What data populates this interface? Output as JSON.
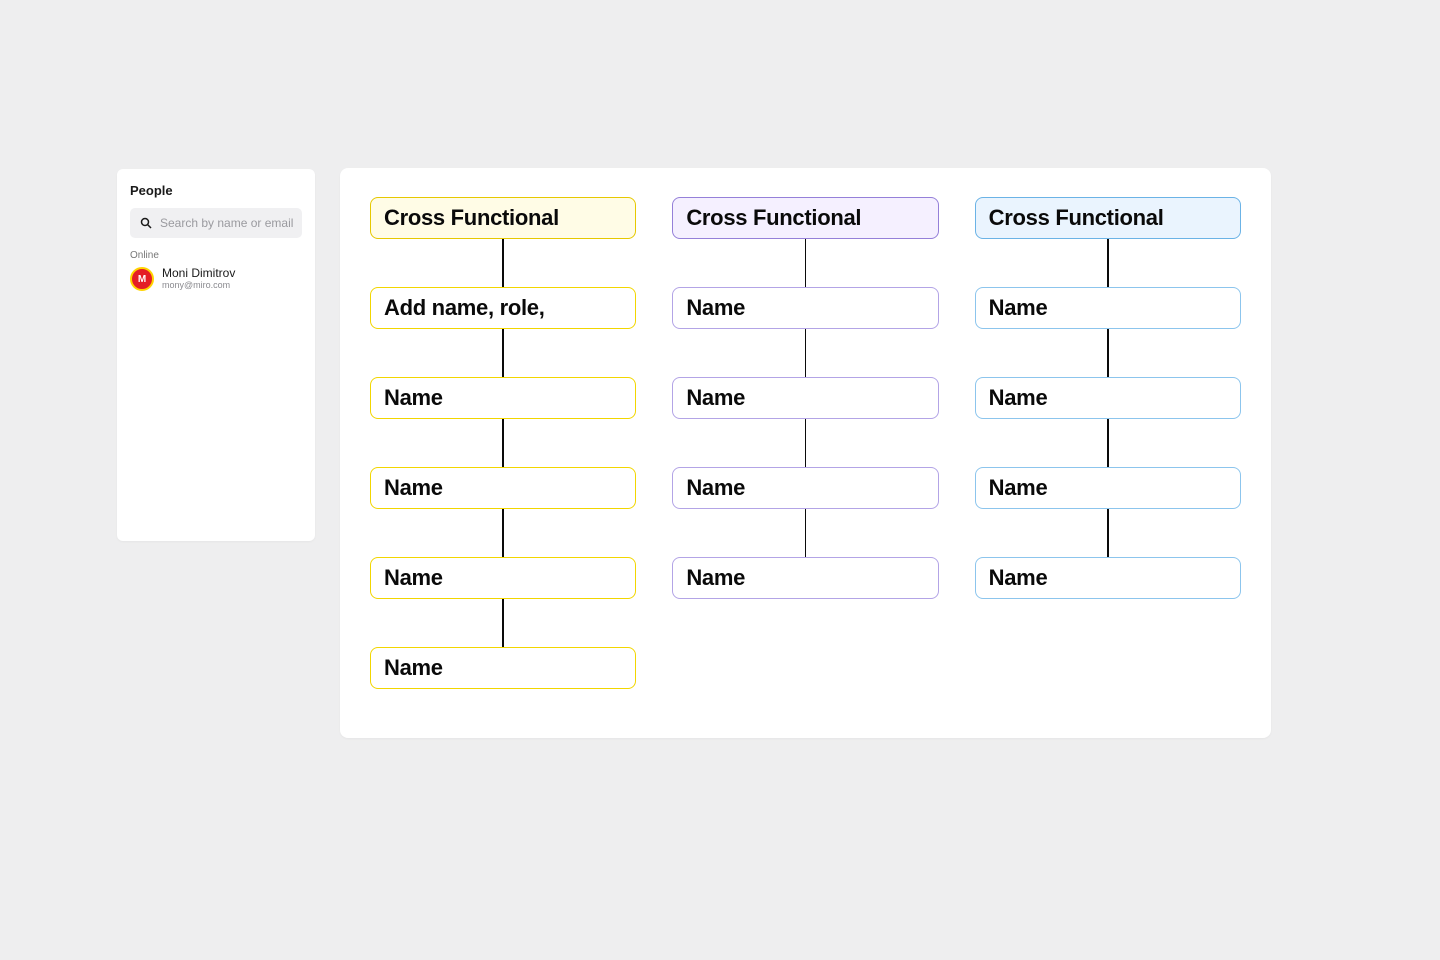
{
  "people_panel": {
    "title": "People",
    "search_placeholder": "Search by name or email",
    "online_label": "Online",
    "users": [
      {
        "initial": "M",
        "name": "Moni Dimitrov",
        "email": "mony@miro.com"
      }
    ]
  },
  "canvas": {
    "columns": [
      {
        "theme": "yellow",
        "header": "Cross Functional",
        "nodes": [
          "Add name, role,",
          "Name",
          "Name",
          "Name",
          "Name"
        ]
      },
      {
        "theme": "purple",
        "header": "Cross Functional",
        "nodes": [
          "Name",
          "Name",
          "Name",
          "Name"
        ]
      },
      {
        "theme": "blue",
        "header": "Cross Functional",
        "nodes": [
          "Name",
          "Name",
          "Name",
          "Name"
        ]
      }
    ]
  }
}
